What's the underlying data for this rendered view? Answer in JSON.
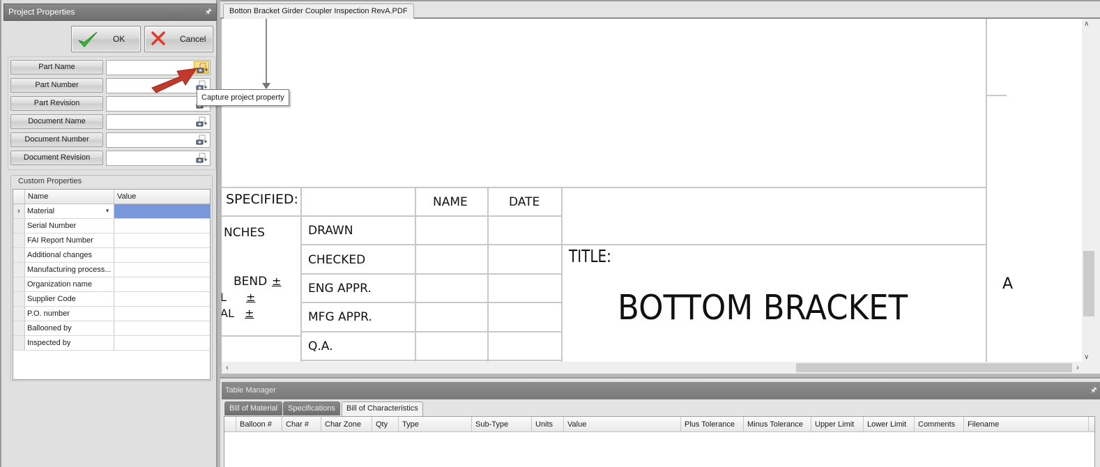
{
  "left_panel": {
    "title": "Project Properties",
    "pin_icon": "pin-icon",
    "ok_label": "OK",
    "cancel_label": "Cancel",
    "properties": [
      {
        "label": "Part Name",
        "value": "",
        "capture_active": true
      },
      {
        "label": "Part Number",
        "value": ""
      },
      {
        "label": "Part Revision",
        "value": ""
      },
      {
        "label": "Document Name",
        "value": ""
      },
      {
        "label": "Document Number",
        "value": ""
      },
      {
        "label": "Document Revision",
        "value": ""
      }
    ],
    "custom_properties": {
      "title": "Custom Properties",
      "columns": [
        "Name",
        "Value"
      ],
      "rows": [
        {
          "name": "Material",
          "value": "",
          "selected": true,
          "dropdown": true
        },
        {
          "name": "Serial Number",
          "value": ""
        },
        {
          "name": "FAI Report Number",
          "value": ""
        },
        {
          "name": "Additional changes",
          "value": ""
        },
        {
          "name": "Manufacturing process...",
          "value": ""
        },
        {
          "name": "Organization name",
          "value": ""
        },
        {
          "name": "Supplier Code",
          "value": ""
        },
        {
          "name": "P.O. number",
          "value": ""
        },
        {
          "name": "Ballooned by",
          "value": ""
        },
        {
          "name": "Inspected by",
          "value": ""
        }
      ],
      "row_indicator": "›"
    }
  },
  "tooltip": "Capture project property",
  "document": {
    "tab_label": "Botton Bracket Girder Coupler Inspection RevA.PDF",
    "title_block": {
      "specified": "SPECIFIED:",
      "inches": "NCHES",
      "bend": "BEND",
      "tol_lines": [
        "L",
        "AL"
      ],
      "plusminus": "±",
      "col_name": "NAME",
      "col_date": "DATE",
      "rows": [
        "DRAWN",
        "CHECKED",
        "ENG APPR.",
        "MFG APPR.",
        "Q.A."
      ],
      "title_label": "TITLE:",
      "title_value": "BOTTOM BRACKET",
      "size_letter": "A"
    }
  },
  "table_manager": {
    "title": "Table Manager",
    "tabs": [
      {
        "label": "Bill of Material",
        "active": false
      },
      {
        "label": "Specifications",
        "active": false
      },
      {
        "label": "Bill of Characteristics",
        "active": true
      }
    ],
    "columns": [
      "Balloon #",
      "Char #",
      "Char Zone",
      "Qty",
      "Type",
      "Sub-Type",
      "Units",
      "Value",
      "Plus Tolerance",
      "Minus Tolerance",
      "Upper Limit",
      "Lower Limit",
      "Comments",
      "Filename"
    ],
    "rows": []
  },
  "colors": {
    "selection": "#7b97dc",
    "capture_highlight": "#f5c24c",
    "annotation_arrow": "#c0392b",
    "ok_check": "#3cb83c",
    "cancel_x": "#e03a2a"
  }
}
